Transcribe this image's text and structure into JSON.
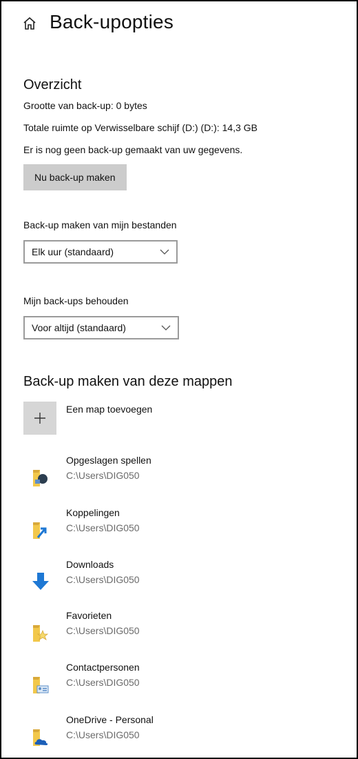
{
  "header": {
    "title": "Back-upopties",
    "icon": "home-icon"
  },
  "overview": {
    "title": "Overzicht",
    "size_line": "Grootte van back-up: 0 bytes",
    "space_line": "Totale ruimte op Verwisselbare schijf (D:) (D:): 14,3 GB",
    "status_line": "Er is nog geen back-up gemaakt van uw gegevens.",
    "backup_now_label": "Nu back-up maken"
  },
  "frequency": {
    "label": "Back-up maken van mijn bestanden",
    "selected": "Elk uur (standaard)"
  },
  "retention": {
    "label": "Mijn back-ups behouden",
    "selected": "Voor altijd (standaard)"
  },
  "folders": {
    "title": "Back-up maken van deze mappen",
    "add_label": "Een map toevoegen",
    "items": [
      {
        "name": "Opgeslagen spellen",
        "path": "C:\\Users\\DIG050",
        "icon": "saved-games-icon"
      },
      {
        "name": "Koppelingen",
        "path": "C:\\Users\\DIG050",
        "icon": "links-icon"
      },
      {
        "name": "Downloads",
        "path": "C:\\Users\\DIG050",
        "icon": "downloads-icon"
      },
      {
        "name": "Favorieten",
        "path": "C:\\Users\\DIG050",
        "icon": "favorites-icon"
      },
      {
        "name": "Contactpersonen",
        "path": "C:\\Users\\DIG050",
        "icon": "contacts-icon"
      },
      {
        "name": "OneDrive - Personal",
        "path": "C:\\Users\\DIG050",
        "icon": "onedrive-icon"
      }
    ]
  },
  "colors": {
    "button_gray": "#cccccc",
    "folder_yellow": "#f2c84b",
    "download_blue": "#1e78d4",
    "path_gray": "#6b6b6b"
  }
}
